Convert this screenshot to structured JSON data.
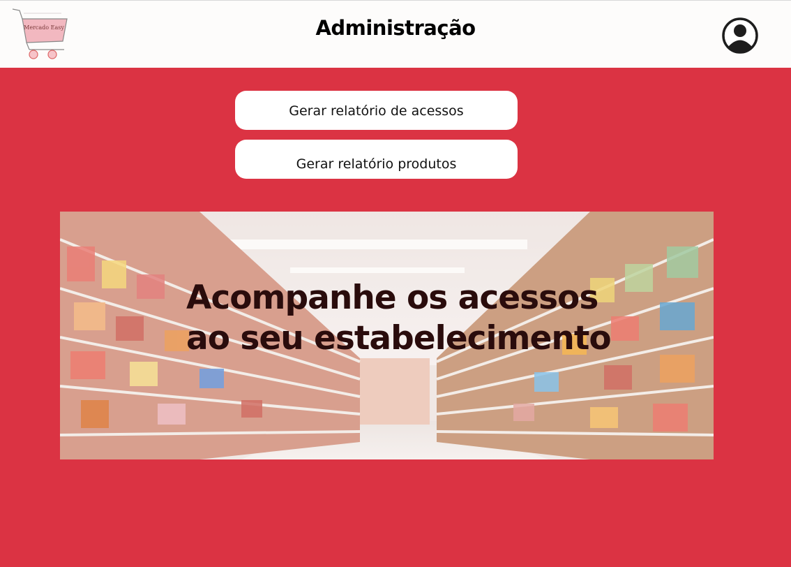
{
  "header": {
    "title": "Administração",
    "logo_text": "Mercado Easy",
    "logo_icon": "shopping-cart-icon",
    "profile_icon": "user-circle-icon"
  },
  "actions": {
    "access_report_label": "Gerar relatório de acessos",
    "products_report_label": "Gerar relatório produtos"
  },
  "banner": {
    "headline_line1": "Acompanhe os acessos",
    "headline_line2": "ao seu estabelecimento"
  },
  "colors": {
    "background": "#db3343",
    "header_bg": "#fdfcfb",
    "button_bg": "#ffffff",
    "headline": "#2a0c0c"
  }
}
